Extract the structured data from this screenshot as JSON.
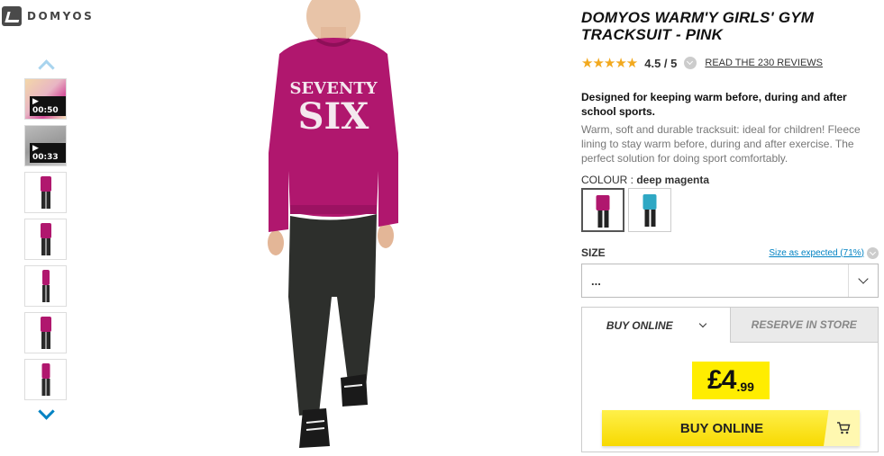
{
  "brand": {
    "logo_text": "DOMYOS"
  },
  "gallery": {
    "thumbnails": [
      {
        "type": "video",
        "duration": "▶ 00:50"
      },
      {
        "type": "video",
        "duration": "▶ 00:33"
      },
      {
        "type": "image"
      },
      {
        "type": "image"
      },
      {
        "type": "image"
      },
      {
        "type": "image"
      },
      {
        "type": "image"
      }
    ]
  },
  "main_image": {
    "shirt_text_line1": "SEVENTY",
    "shirt_text_line2": "SIX",
    "shirt_color": "#b0176e",
    "pants_color": "#2d2f2c"
  },
  "product": {
    "title": "DOMYOS WARM'Y GIRLS' GYM TRACKSUIT - PINK",
    "rating_value": "4.5 / 5",
    "rating_stars": 4.5,
    "reviews_link": "READ THE 230 REVIEWS",
    "desc_title": "Designed for keeping warm before, during and after school sports.",
    "desc": "Warm, soft and durable tracksuit: ideal for children! Fleece lining to stay warm before, during and after exercise. The perfect solution for doing sport comfortably.",
    "colour_label": "COLOUR : ",
    "colour_value": "deep magenta",
    "swatches": [
      {
        "color": "#b0176e",
        "selected": true
      },
      {
        "color": "#2fa8c4",
        "selected": false
      }
    ],
    "size_label": "SIZE",
    "size_fit_link": "Size as expected (71%)",
    "size_selected": "..."
  },
  "purchase": {
    "tab_buy_online": "BUY ONLINE",
    "tab_reserve": "RESERVE IN STORE",
    "price_main": "£4",
    "price_cents": ".99",
    "buy_button": "BUY ONLINE"
  },
  "colors": {
    "accent_blue": "#0082c3",
    "price_yellow": "#ffed00",
    "star": "#f2a91e"
  }
}
